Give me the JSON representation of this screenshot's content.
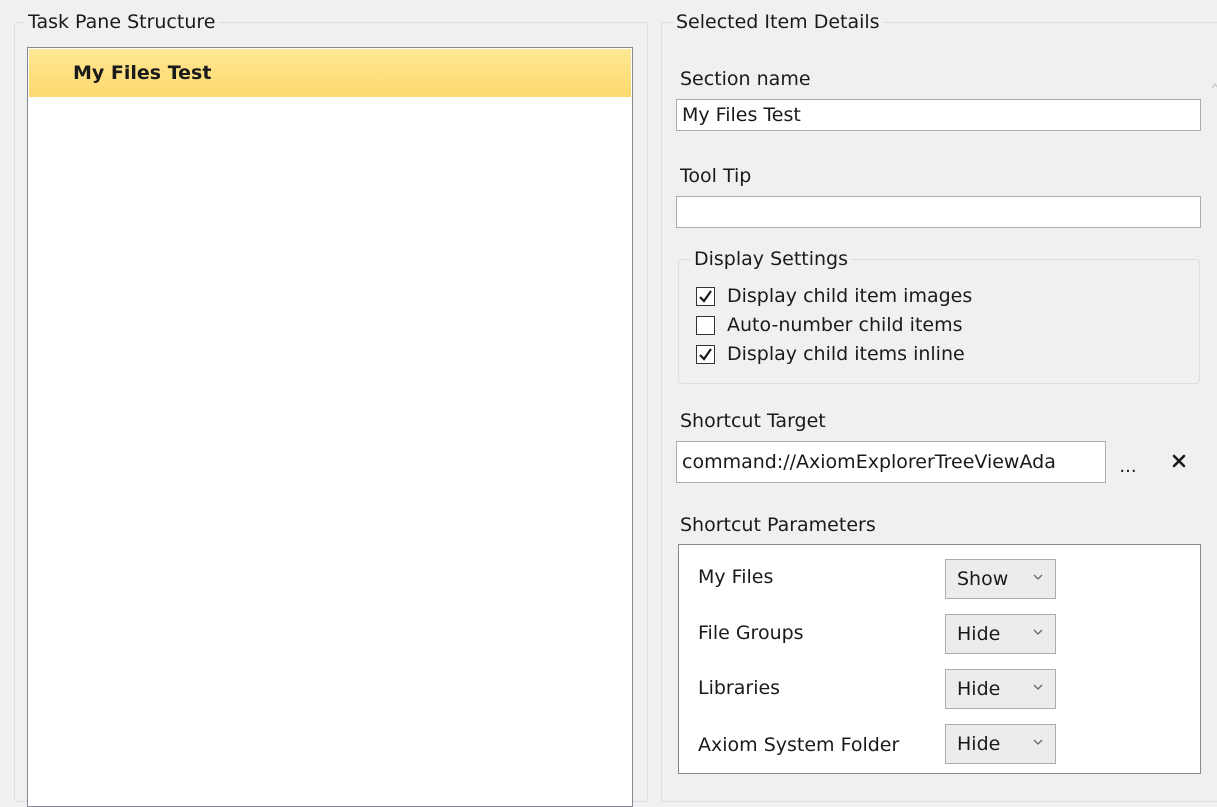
{
  "task_pane": {
    "legend": "Task Pane Structure",
    "tree": {
      "items": [
        {
          "label": "My Files Test",
          "selected": true
        }
      ]
    }
  },
  "details": {
    "legend": "Selected Item Details",
    "section_name": {
      "label": "Section name",
      "value": "My Files Test"
    },
    "tool_tip": {
      "label": "Tool Tip",
      "value": ""
    },
    "display_settings": {
      "legend": "Display Settings",
      "options": [
        {
          "label": "Display child item images",
          "checked": true
        },
        {
          "label": "Auto-number child items",
          "checked": false
        },
        {
          "label": "Display child items inline",
          "checked": true
        }
      ]
    },
    "shortcut_target": {
      "label": "Shortcut Target",
      "value": "command://AxiomExplorerTreeViewAda",
      "browse_label": "...",
      "clear_icon": "close-icon"
    },
    "shortcut_parameters": {
      "label": "Shortcut Parameters",
      "rows": [
        {
          "label": "My Files",
          "value": "Show"
        },
        {
          "label": "File Groups",
          "value": "Hide"
        },
        {
          "label": "Libraries",
          "value": "Hide"
        },
        {
          "label": "Axiom System Folder",
          "value": "Hide"
        }
      ]
    }
  },
  "colors": {
    "selection": "#fcd96d",
    "background": "#f0f0f0",
    "groupbox_border": "#d5dfe5"
  }
}
